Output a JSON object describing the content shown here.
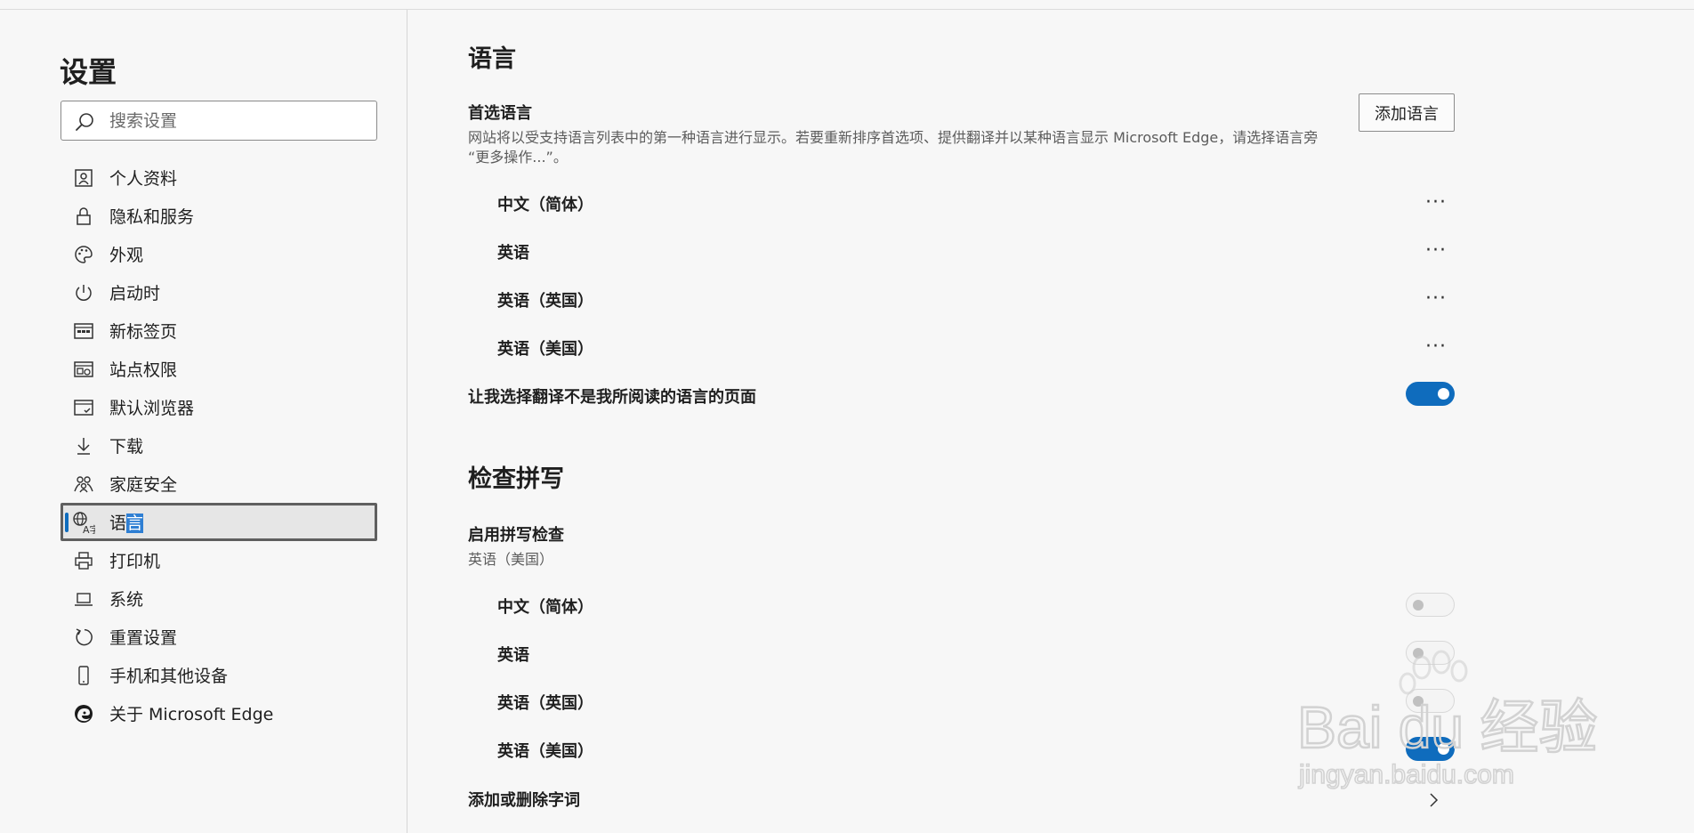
{
  "sidebar": {
    "title": "设置",
    "search_placeholder": "搜索设置",
    "items": [
      {
        "label": "个人资料",
        "icon": "profile-icon"
      },
      {
        "label": "隐私和服务",
        "icon": "lock-icon"
      },
      {
        "label": "外观",
        "icon": "palette-icon"
      },
      {
        "label": "启动时",
        "icon": "power-icon"
      },
      {
        "label": "新标签页",
        "icon": "new-tab-icon"
      },
      {
        "label": "站点权限",
        "icon": "site-permissions-icon"
      },
      {
        "label": "默认浏览器",
        "icon": "default-browser-icon"
      },
      {
        "label": "下载",
        "icon": "download-icon"
      },
      {
        "label": "家庭安全",
        "icon": "family-icon"
      },
      {
        "label_pre": "语",
        "label_sel": "言",
        "icon": "language-icon",
        "active": true
      },
      {
        "label": "打印机",
        "icon": "printer-icon"
      },
      {
        "label": "系统",
        "icon": "laptop-icon"
      },
      {
        "label": "重置设置",
        "icon": "reset-icon"
      },
      {
        "label": "手机和其他设备",
        "icon": "phone-icon"
      },
      {
        "label": "关于 Microsoft Edge",
        "icon": "edge-logo-icon"
      }
    ]
  },
  "language": {
    "title": "语言",
    "preferred_label": "首选语言",
    "preferred_desc_line1": "网站将以受支持语言列表中的第一种语言进行显示。若要重新排序首选项、提供翻译并以某种语言显示 Microsoft Edge，请选择语言旁",
    "preferred_desc_line2": "“更多操作...”。",
    "add_button": "添加语言",
    "languages": [
      "中文（简体）",
      "英语",
      "英语（英国）",
      "英语（美国）"
    ],
    "more_label": "···",
    "translate_label": "让我选择翻译不是我所阅读的语言的页面",
    "translate_on": true
  },
  "spellcheck": {
    "title": "检查拼写",
    "enable_label": "启用拼写检查",
    "enable_sub": "英语（美国）",
    "languages": [
      {
        "label": "中文（简体）",
        "on": false
      },
      {
        "label": "英语",
        "on": false
      },
      {
        "label": "英语（英国）",
        "on": false
      },
      {
        "label": "英语（美国）",
        "on": true
      }
    ],
    "dictionary_label": "添加或删除字词"
  },
  "watermark": {
    "brand": "Bai du 经验",
    "url": "jingyan.baidu.com"
  },
  "colors": {
    "accent": "#0f6cbd",
    "background": "#f7f7f7"
  }
}
